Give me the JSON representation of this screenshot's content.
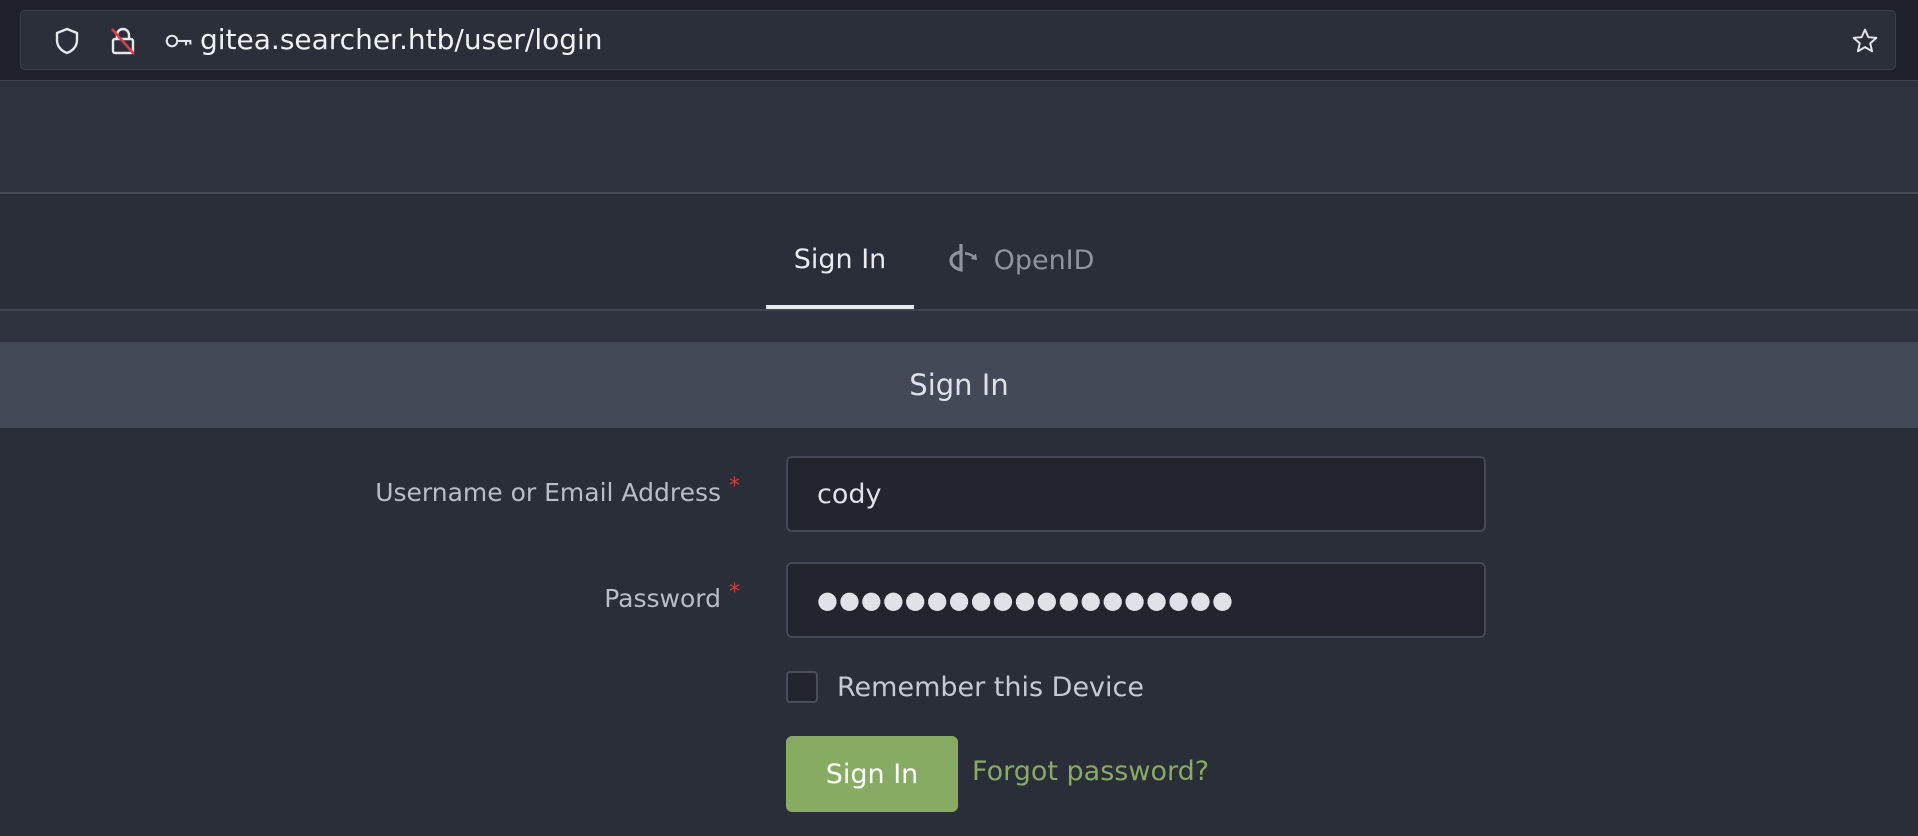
{
  "browser": {
    "url": "gitea.searcher.htb/user/login",
    "icons": [
      "shield-icon",
      "lock-insecure-icon",
      "key-icon",
      "star-icon"
    ]
  },
  "tabs": [
    {
      "label": "Sign In",
      "active": true
    },
    {
      "label": "OpenID",
      "active": false,
      "icon": "openid-icon"
    }
  ],
  "card": {
    "title": "Sign In"
  },
  "form": {
    "username_label": "Username or Email Address",
    "username_value": "cody",
    "password_label": "Password",
    "password_value": "●●●●●●●●●●●●●●●●●●●",
    "required_marker": "*",
    "remember_label": "Remember this Device",
    "remember_checked": false,
    "submit_label": "Sign In",
    "forgot_label": "Forgot password?"
  },
  "colors": {
    "primary": "#87ab63",
    "required": "#d43c3c",
    "background": "#2e323e"
  }
}
